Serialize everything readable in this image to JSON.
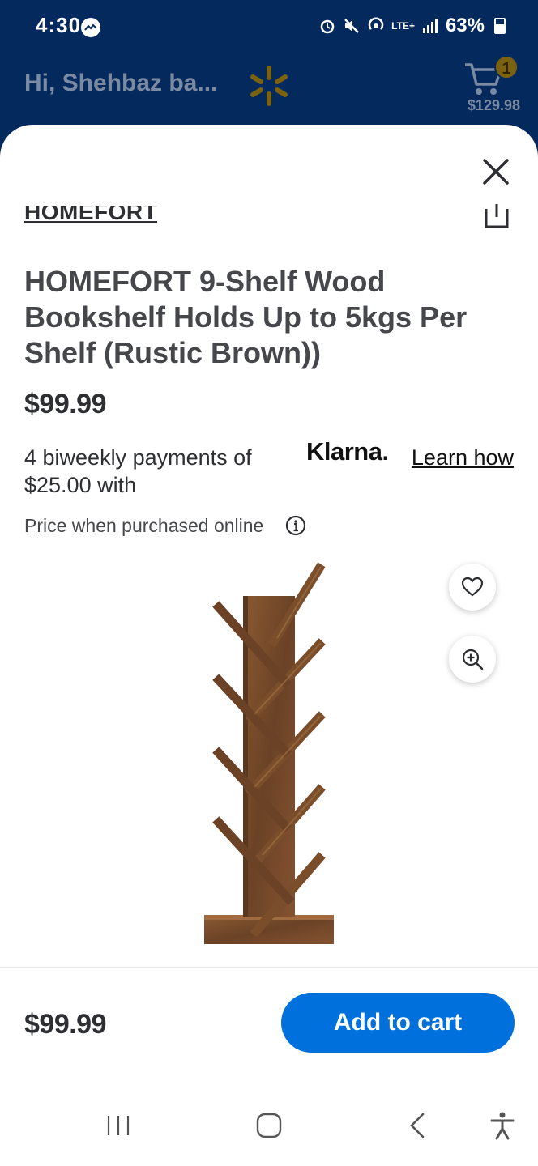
{
  "status_bar": {
    "time": "4:30",
    "battery": "63%",
    "network": "LTE+"
  },
  "header": {
    "greeting": "Hi, Shehbaz ba...",
    "cart_count": "1",
    "cart_total": "$129.98"
  },
  "product": {
    "brand": "HOMEFORT",
    "title": "HOMEFORT 9-Shelf Wood Bookshelf Holds Up to 5kgs Per Shelf (Rustic Brown))",
    "price": "$99.99",
    "klarna_text": "4 biweekly payments of $25.00 with",
    "klarna_logo": "Klarna.",
    "learn_how": "Learn how",
    "online_note": "Price when purchased online"
  },
  "footer": {
    "price": "$99.99",
    "add_to_cart": "Add to cart"
  },
  "colors": {
    "header_bg": "#04295d",
    "primary_button": "#0071dc",
    "wood": "#7a4e2a"
  },
  "icons": [
    "close-icon",
    "share-icon",
    "info-icon",
    "heart-icon",
    "zoom-in-icon",
    "cart-icon",
    "spark-logo-icon"
  ]
}
